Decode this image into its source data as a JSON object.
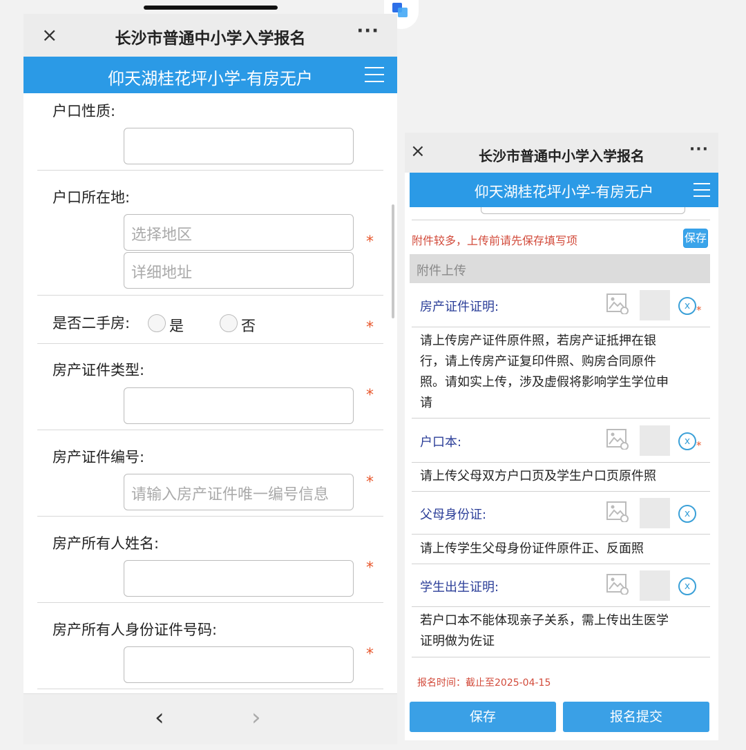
{
  "left": {
    "title": "长沙市普通中小学入学报名",
    "subtitle": "仰天湖桂花坪小学-有房无户",
    "fields": {
      "hukou_type": {
        "label": "户口性质:",
        "value": ""
      },
      "hukou_location": {
        "label": "户口所在地:",
        "region_placeholder": "选择地区",
        "address_placeholder": "详细地址"
      },
      "second_hand": {
        "label": "是否二手房:",
        "yes": "是",
        "no": "否"
      },
      "cert_type": {
        "label": "房产证件类型:",
        "value": ""
      },
      "cert_number": {
        "label": "房产证件编号:",
        "placeholder": "请输入房产证件唯一编号信息"
      },
      "owner_name": {
        "label": "房产所有人姓名:",
        "value": ""
      },
      "owner_id": {
        "label": "房产所有人身份证件号码:",
        "value": ""
      }
    },
    "required_mark": "*"
  },
  "right": {
    "title": "长沙市普通中小学入学报名",
    "subtitle": "仰天湖桂花坪小学-有房无户",
    "warning": "附件较多，上传前请先保存填写项",
    "save_small": "保存",
    "section": "附件上传",
    "attachments": [
      {
        "label": "房产证件证明:",
        "required": true,
        "desc_lines": [
          "请上传房产证件原件照，若房产证抵押在银",
          "行，请上传房产证复印件照、购房合同原件",
          "照。请如实上传，涉及虚假将影响学生学位申",
          "请"
        ]
      },
      {
        "label": "户口本:",
        "required": true,
        "desc_lines": [
          "请上传父母双方户口页及学生户口页原件照"
        ]
      },
      {
        "label": "父母身份证:",
        "required": false,
        "desc_lines": [
          "请上传学生父母身份证件原件正、反面照"
        ]
      },
      {
        "label": "学生出生证明:",
        "required": false,
        "desc_lines": [
          "若户口本不能体现亲子关系，需上传出生医学",
          "证明做为佐证"
        ]
      }
    ],
    "deadline": "报名时间：截止至2025-04-15",
    "save_button": "保存",
    "submit_button": "报名提交",
    "remove_glyph": "x"
  },
  "icons": {
    "close": "×",
    "more": "···",
    "prev": "‹",
    "next": "›"
  },
  "colors": {
    "brand_blue": "#2b9ae6",
    "required_red": "#e8572c",
    "label_navy": "#2b3e98",
    "warning_red": "#d24a3a"
  }
}
